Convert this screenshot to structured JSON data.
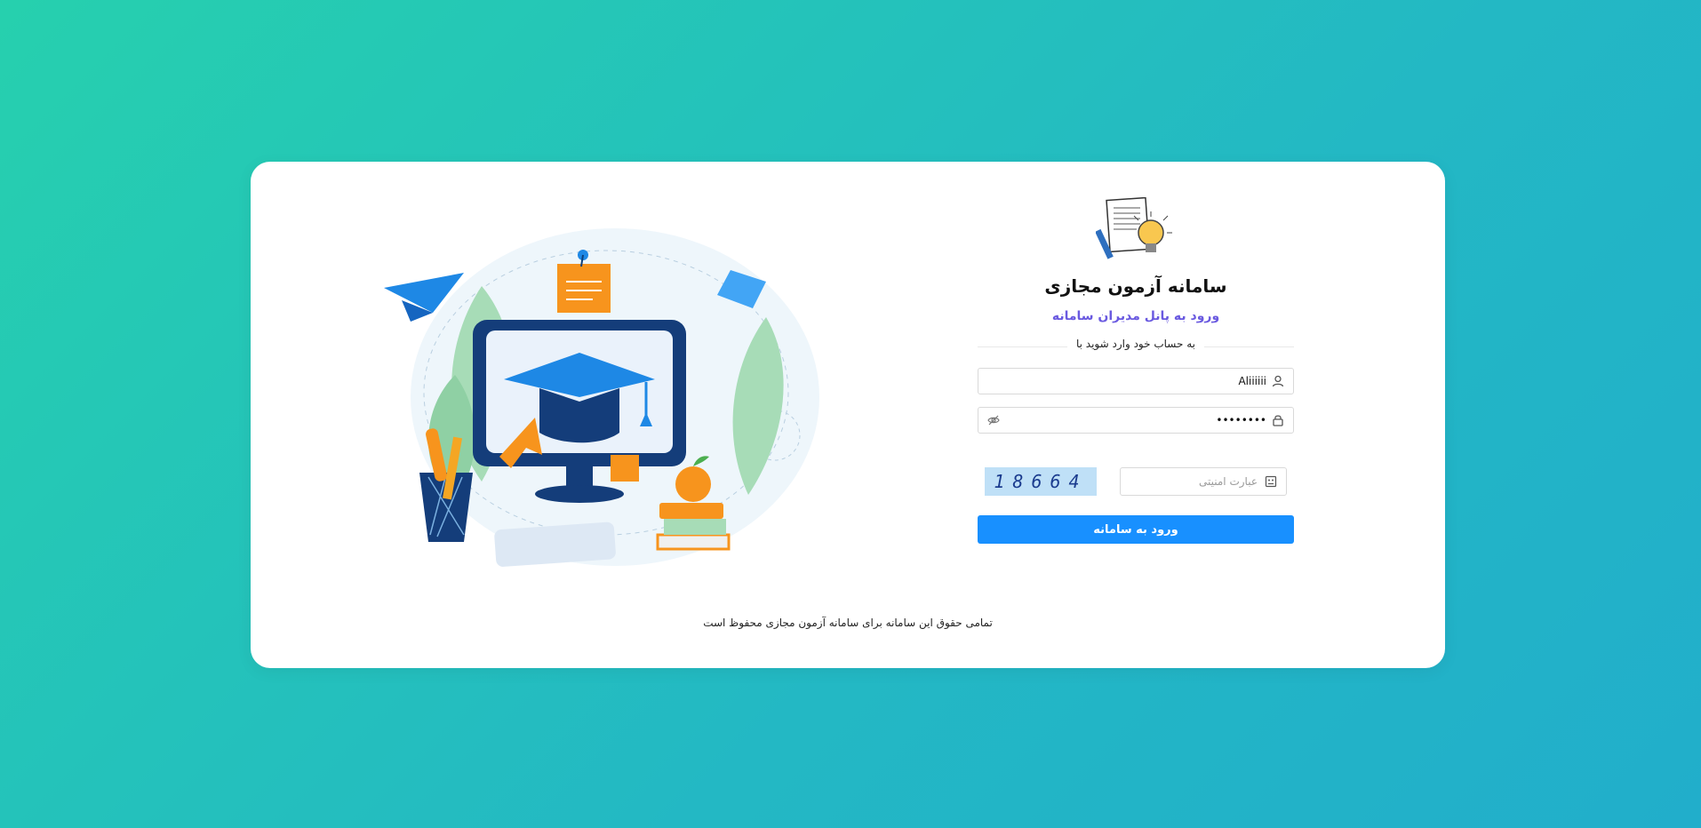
{
  "header": {
    "title": "سامانه آزمون مجازی",
    "subtitle": "ورود به پانل مدیران سامانه",
    "divider_text": "به حساب خود وارد شوید با"
  },
  "form": {
    "username_value": "Aliiiiii",
    "password_value": "••••••••",
    "captcha_placeholder": "عبارت امنیتی",
    "captcha_code": "18664",
    "submit_label": "ورود به سامانه"
  },
  "footer": {
    "copyright": "تمامی حقوق این سامانه برای سامانه آزمون مجازی محفوظ است"
  },
  "icons": {
    "username": "user-icon",
    "password": "lock-icon",
    "toggle": "eye-slash-icon",
    "captcha": "captcha-icon"
  },
  "colors": {
    "background_start": "#26d0ae",
    "background_end": "#21aecb",
    "subtitle": "#6a5ae0",
    "primary_button": "#1890ff",
    "captcha_bg": "#bfe0f7"
  }
}
